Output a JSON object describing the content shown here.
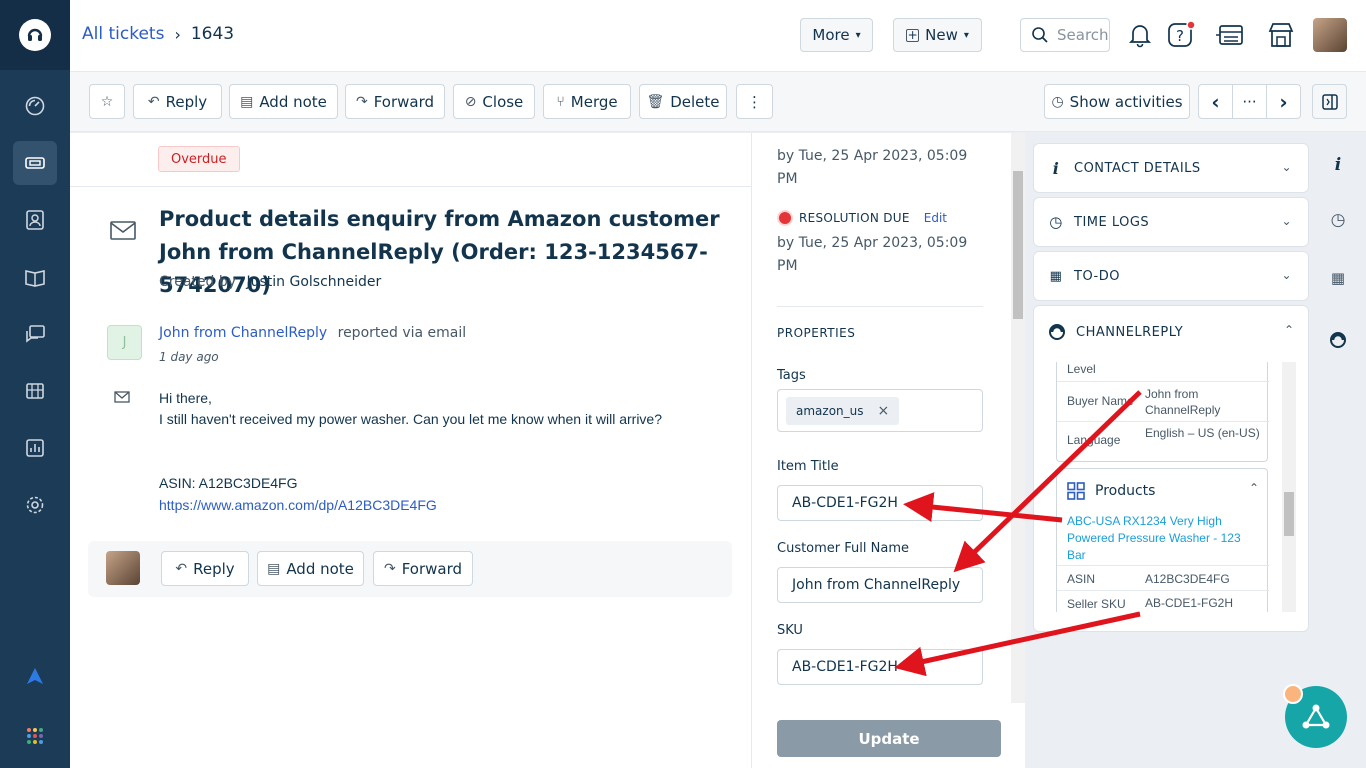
{
  "header": {
    "breadcrumb_link": "All tickets",
    "breadcrumb_sep": "›",
    "ticket_id": "1643",
    "more_label": "More",
    "new_label": "New",
    "search_placeholder": "Search"
  },
  "toolbar": {
    "reply": "Reply",
    "add_note": "Add note",
    "forward": "Forward",
    "close": "Close",
    "merge": "Merge",
    "delete": "Delete",
    "more": "⋮",
    "show_activities": "Show activities",
    "nav_prev": "‹",
    "nav_mid": "···",
    "nav_next": "›"
  },
  "ticket": {
    "status_badge": "Overdue",
    "subject": "Product details enquiry from Amazon customer John from ChannelReply (Order: 123-1234567-5742070)",
    "created_by_label": "Created by",
    "created_by": "Justin Golschneider",
    "reporter_initial": "J",
    "reporter_name": "John from ChannelReply",
    "reporter_suffix": "reported via email",
    "time_ago": "1 day ago",
    "body_line1": "Hi there,",
    "body_line2": "I still haven't received my power washer. Can you let me know when it will arrive?",
    "body_asin": "ASIN: A12BC3DE4FG",
    "body_url": "https://www.amazon.com/dp/A12BC3DE4FG"
  },
  "reply_bar": {
    "reply": "Reply",
    "add_note": "Add note",
    "forward": "Forward"
  },
  "properties": {
    "first_due_text": "by Tue, 25 Apr 2023, 05:09 PM",
    "resolution_label": "RESOLUTION DUE",
    "resolution_edit": "Edit",
    "resolution_text": "by Tue, 25 Apr 2023, 05:09 PM",
    "section_title": "PROPERTIES",
    "tags_label": "Tags",
    "tag_value": "amazon_us",
    "tag_remove": "×",
    "item_title_label": "Item Title",
    "item_title_value": "AB-CDE1-FG2H",
    "customer_name_label": "Customer Full Name",
    "customer_name_value": "John from ChannelReply",
    "sku_label": "SKU",
    "sku_value": "AB-CDE1-FG2H",
    "update_button": "Update"
  },
  "apps": {
    "contact_details": "CONTACT DETAILS",
    "time_logs": "TIME LOGS",
    "todo": "TO-DO",
    "channelreply": "CHANNELREPLY",
    "rows": [
      {
        "key": "Level",
        "value": ""
      },
      {
        "key": "Buyer Name",
        "value": "John from ChannelReply"
      },
      {
        "key": "Language",
        "value": "English – US (en-US)"
      }
    ],
    "products_title": "Products",
    "product_link": "ABC-USA RX1234 Very High Powered Pressure Washer - 123 Bar",
    "product_rows": [
      {
        "key": "ASIN",
        "value": "A12BC3DE4FG"
      },
      {
        "key": "Seller SKU",
        "value": "AB-CDE1-FG2H"
      }
    ]
  },
  "colors": {
    "sidebar": "#1c3b57",
    "accent_link": "#2c5cc5",
    "arrow": "#e0141c",
    "fab": "#16a6a8"
  }
}
